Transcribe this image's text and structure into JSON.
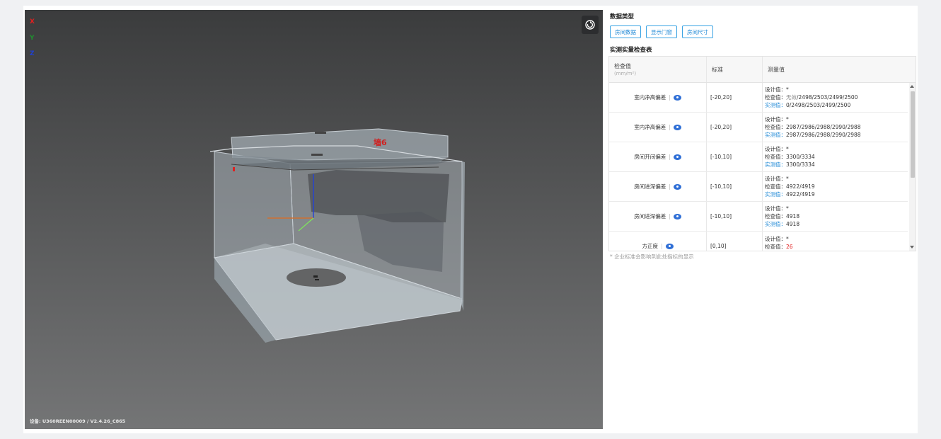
{
  "viewer": {
    "axes": {
      "x": "X",
      "y": "Y",
      "z": "Z"
    },
    "axis_colors": {
      "x": "#e02020",
      "y": "#1f8f2f",
      "z": "#2040d0"
    },
    "wall_label": "墙6",
    "device_info": "设备: U360REEN00009 / V2.4.26_C865",
    "reset_icon": "rotate-reset-icon"
  },
  "panel": {
    "data_type_title": "数据类型",
    "buttons": [
      "房间数据",
      "显示门窗",
      "房间尺寸"
    ],
    "table_title": "实测实量检查表",
    "headers": {
      "check": "检查值",
      "check_unit": "(mm/m²)",
      "standard": "标准",
      "measured": "测量值"
    },
    "labels": {
      "design": "设计值：",
      "check": "检查值：",
      "actual": "实测值："
    },
    "rows": [
      {
        "name": "室内净高偏差",
        "standard": "[-20,20]",
        "design": "*",
        "check_invalid": "无效",
        "check": "/2498/2503/2499/2500",
        "actual": "0/2498/2503/2499/2500"
      },
      {
        "name": "室内净高偏差",
        "standard": "[-20,20]",
        "design": "*",
        "check_invalid": "",
        "check": "2987/2986/2988/2990/2988",
        "actual": "2987/2986/2988/2990/2988"
      },
      {
        "name": "房间开间偏差",
        "standard": "[-10,10]",
        "design": "*",
        "check_invalid": "",
        "check": "3300/3334",
        "actual": "3300/3334"
      },
      {
        "name": "房间进深偏差",
        "standard": "[-10,10]",
        "design": "*",
        "check_invalid": "",
        "check": "4922/4919",
        "actual": "4922/4919"
      },
      {
        "name": "房间进深偏差",
        "standard": "[-10,10]",
        "design": "*",
        "check_invalid": "",
        "check": "4918",
        "actual": "4918"
      },
      {
        "name": "方正度",
        "standard": "[0,10]",
        "design": "*",
        "check_invalid": "",
        "check_red": "26",
        "check": "",
        "actual": "26"
      }
    ],
    "footnote": "* 企业标准会影响到此处指标的显示"
  }
}
